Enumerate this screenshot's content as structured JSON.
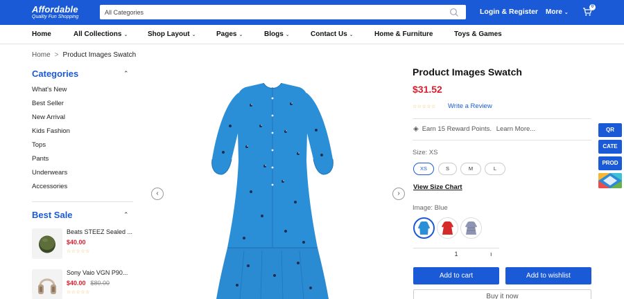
{
  "header": {
    "brand": "Affordable",
    "tagline": "Quality Fun Shopping",
    "search_placeholder": "All Categories",
    "login_label": "Login & Register",
    "more_label": "More",
    "cart_count": "0"
  },
  "nav": {
    "items": [
      {
        "label": "Home",
        "has_dropdown": false
      },
      {
        "label": "All Collections",
        "has_dropdown": true
      },
      {
        "label": "Shop Layout",
        "has_dropdown": true
      },
      {
        "label": "Pages",
        "has_dropdown": true
      },
      {
        "label": "Blogs",
        "has_dropdown": true
      },
      {
        "label": "Contact Us",
        "has_dropdown": true
      },
      {
        "label": "Home & Furniture",
        "has_dropdown": false
      },
      {
        "label": "Toys & Games",
        "has_dropdown": false
      }
    ]
  },
  "breadcrumb": {
    "home": "Home",
    "separator": ">",
    "current": "Product Images Swatch"
  },
  "sidebar": {
    "categories_title": "Categories",
    "categories": [
      "What's New",
      "Best Seller",
      "New Arrival",
      "Kids Fashion",
      "Tops",
      "Pants",
      "Underwears",
      "Accessories"
    ],
    "best_sale_title": "Best Sale",
    "best_sale": [
      {
        "name": "Beats STEEZ Sealed ...",
        "price": "$40.00",
        "old_price": "",
        "stars": "☆☆☆☆☆",
        "icon": "speaker-icon"
      },
      {
        "name": "Sony Vaio VGN P90...",
        "price": "$40.00",
        "old_price": "$80.00",
        "stars": "☆☆☆☆☆",
        "icon": "headphones-icon"
      }
    ]
  },
  "gallery": {
    "prev_label": "‹",
    "next_label": "›"
  },
  "product": {
    "title": "Product Images Swatch",
    "price": "$31.52",
    "stars": "☆☆☆☆☆",
    "write_review": "Write a Review",
    "reward_text": "Earn 15 Reward Points.",
    "learn_more": "Learn More...",
    "size_label": "Size: XS",
    "sizes": [
      "XS",
      "S",
      "M",
      "L"
    ],
    "selected_size": "XS",
    "size_chart_label": "View Size Chart",
    "image_label": "Image: Blue",
    "swatches": [
      "Blue",
      "Red",
      "Gray"
    ],
    "selected_swatch": "Blue",
    "quantity": "1",
    "qty_increment": "ı",
    "add_to_cart": "Add to cart",
    "add_to_wishlist": "Add to wishlist",
    "buy_now": "Buy it now"
  },
  "float_tabs": [
    "QR",
    "CATE",
    "PROD"
  ],
  "colors": {
    "primary": "#1a5ad7",
    "price": "#d81d2c",
    "dress": "#2b8fd8",
    "star": "#e9b44c"
  }
}
